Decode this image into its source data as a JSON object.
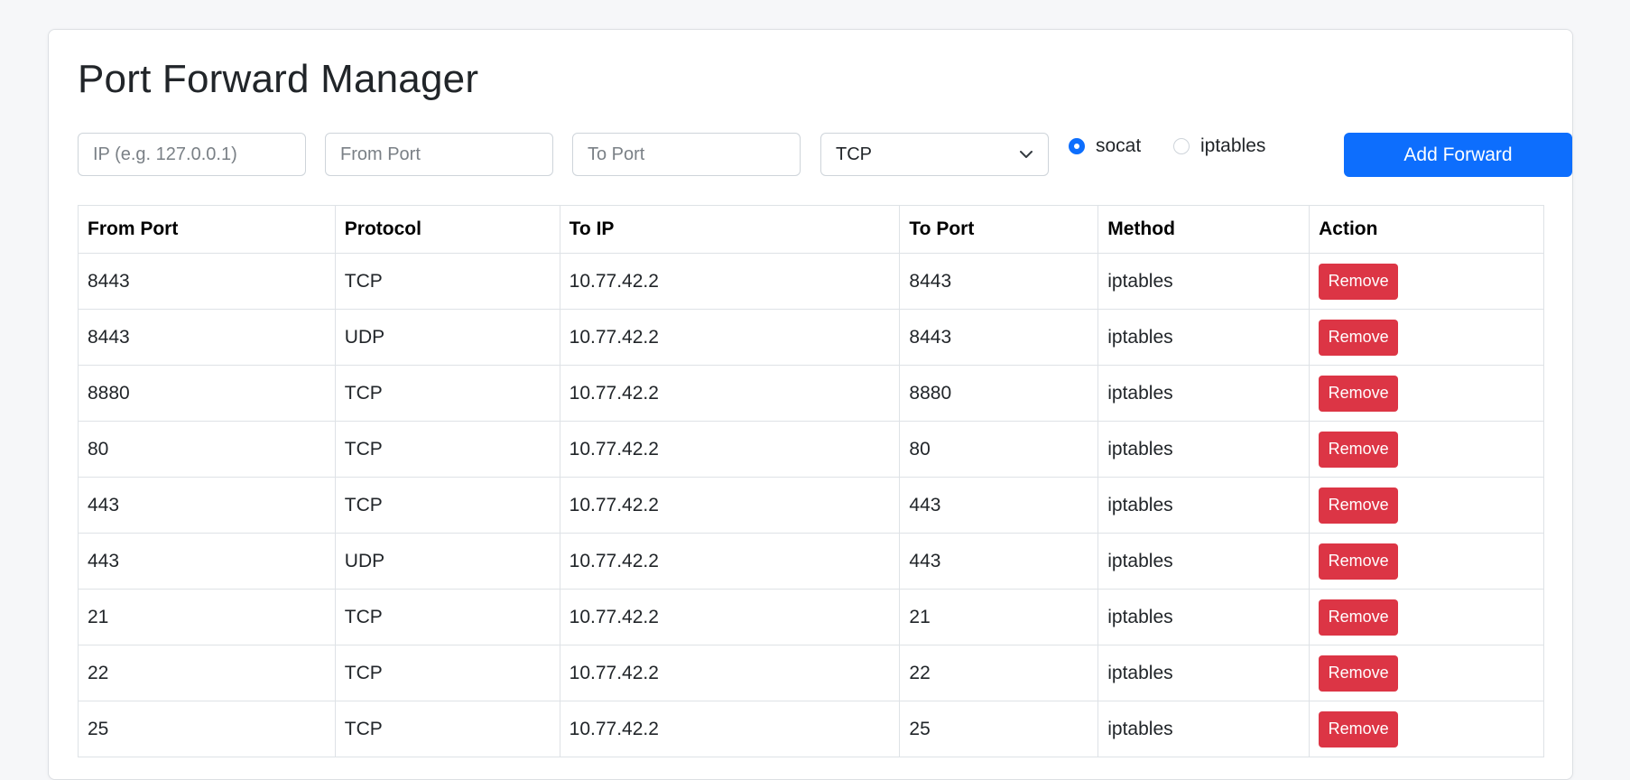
{
  "page": {
    "title": "Port Forward Manager"
  },
  "form": {
    "ip_placeholder": "IP (e.g. 127.0.0.1)",
    "from_port_placeholder": "From Port",
    "to_port_placeholder": "To Port",
    "protocol_selected": "TCP",
    "method_options": [
      {
        "label": "socat",
        "checked": true
      },
      {
        "label": "iptables",
        "checked": false
      }
    ],
    "add_button": "Add Forward"
  },
  "table": {
    "headers": [
      "From Port",
      "Protocol",
      "To IP",
      "To Port",
      "Method",
      "Action"
    ],
    "rows": [
      {
        "from_port": "8443",
        "protocol": "TCP",
        "to_ip": "10.77.42.2",
        "to_port": "8443",
        "method": "iptables",
        "action": "Remove"
      },
      {
        "from_port": "8443",
        "protocol": "UDP",
        "to_ip": "10.77.42.2",
        "to_port": "8443",
        "method": "iptables",
        "action": "Remove"
      },
      {
        "from_port": "8880",
        "protocol": "TCP",
        "to_ip": "10.77.42.2",
        "to_port": "8880",
        "method": "iptables",
        "action": "Remove"
      },
      {
        "from_port": "80",
        "protocol": "TCP",
        "to_ip": "10.77.42.2",
        "to_port": "80",
        "method": "iptables",
        "action": "Remove"
      },
      {
        "from_port": "443",
        "protocol": "TCP",
        "to_ip": "10.77.42.2",
        "to_port": "443",
        "method": "iptables",
        "action": "Remove"
      },
      {
        "from_port": "443",
        "protocol": "UDP",
        "to_ip": "10.77.42.2",
        "to_port": "443",
        "method": "iptables",
        "action": "Remove"
      },
      {
        "from_port": "21",
        "protocol": "TCP",
        "to_ip": "10.77.42.2",
        "to_port": "21",
        "method": "iptables",
        "action": "Remove"
      },
      {
        "from_port": "22",
        "protocol": "TCP",
        "to_ip": "10.77.42.2",
        "to_port": "22",
        "method": "iptables",
        "action": "Remove"
      },
      {
        "from_port": "25",
        "protocol": "TCP",
        "to_ip": "10.77.42.2",
        "to_port": "25",
        "method": "iptables",
        "action": "Remove"
      }
    ]
  },
  "colors": {
    "primary": "#0d6efd",
    "danger": "#dc3545",
    "background": "#f6f7f9"
  }
}
